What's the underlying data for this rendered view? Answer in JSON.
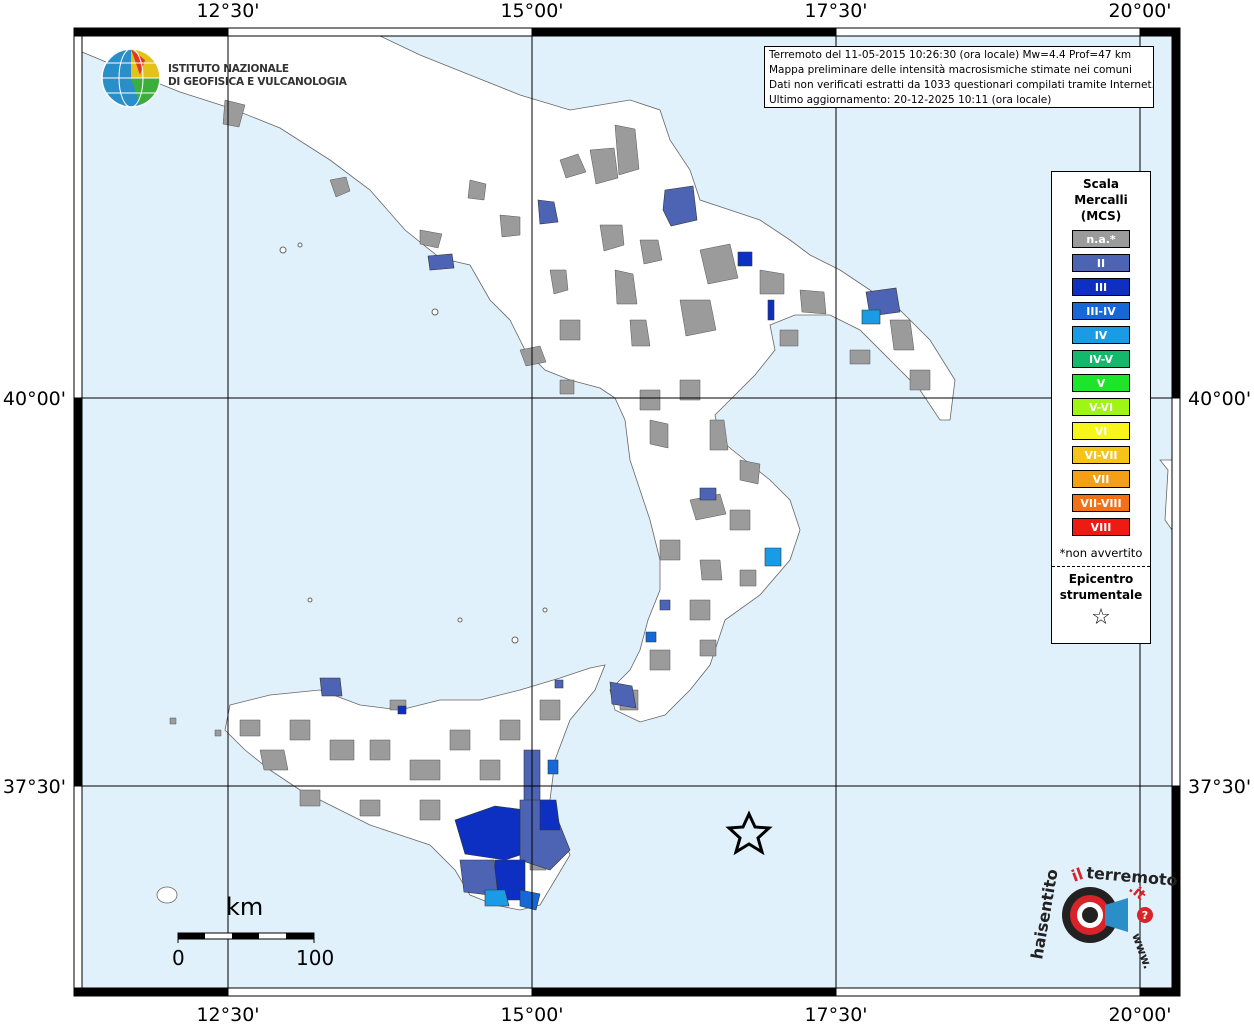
{
  "coords": {
    "top": [
      "12°30'",
      "15°00'",
      "17°30'",
      "20°00'"
    ],
    "bottom": [
      "12°30'",
      "15°00'",
      "17°30'",
      "20°00'"
    ],
    "left": [
      "40°00'",
      "37°30'"
    ],
    "right": [
      "40°00'",
      "37°30'"
    ]
  },
  "logo": {
    "line1": "ISTITUTO NAZIONALE",
    "line2": "DI GEOFISICA E VULCANOLOGIA"
  },
  "info": {
    "line1": "Terremoto del 11-05-2015 10:26:30 (ora locale) Mw=4.4 Prof=47 km",
    "line2": "Mappa preliminare delle intensità macrosismiche stimate nei comuni",
    "line3": "Dati non verificati estratti da 1033 questionari compilati tramite Internet.",
    "line4": "Ultimo aggiornamento: 20-12-2025 10:11 (ora locale)"
  },
  "legend": {
    "title1": "Scala",
    "title2": "Mercalli",
    "title3": "(MCS)",
    "items": [
      {
        "label": "n.a.*",
        "color": "#9b9b9b"
      },
      {
        "label": "II",
        "color": "#4d64b4"
      },
      {
        "label": "III",
        "color": "#0d2fc2"
      },
      {
        "label": "III-IV",
        "color": "#1568d6"
      },
      {
        "label": "IV",
        "color": "#1a9be6"
      },
      {
        "label": "IV-V",
        "color": "#13b86a"
      },
      {
        "label": "V",
        "color": "#1de52a"
      },
      {
        "label": "V-VI",
        "color": "#9ef516"
      },
      {
        "label": "VI",
        "color": "#f8f51a"
      },
      {
        "label": "VI-VII",
        "color": "#f6c418"
      },
      {
        "label": "VII",
        "color": "#f59f17"
      },
      {
        "label": "VII-VIII",
        "color": "#f37114"
      },
      {
        "label": "VIII",
        "color": "#ee1b12"
      }
    ],
    "note": "*non avvertito",
    "epi1": "Epicentro",
    "epi2": "strumentale",
    "star": "☆"
  },
  "scale": {
    "unit": "km",
    "start": "0",
    "end": "100"
  },
  "badge": {
    "text_left": "haisentito",
    "text_mid": "il",
    "text_right": "terremoto",
    "text_it": ".it",
    "text_www": "www.",
    "question": "?"
  },
  "colors": {
    "sea": "#e1f1fb",
    "land": "#ffffff",
    "na": "#9b9b9b",
    "frame": "#000000"
  }
}
